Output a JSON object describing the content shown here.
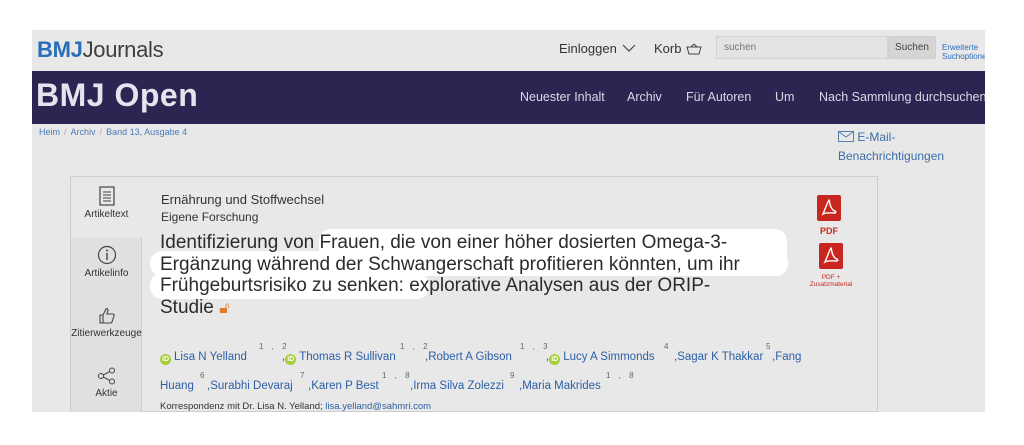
{
  "header": {
    "logo_brand": "BMJ",
    "logo_rest": "Journals",
    "login_label": "Einloggen",
    "cart_label": "Korb",
    "search_placeholder": "suchen",
    "search_button": "Suchen",
    "advanced_search_line1": "Erweiterte",
    "advanced_search_line2": "Suchoptionen"
  },
  "navbar": {
    "journal": "BMJ Open",
    "items": [
      "Neuester Inhalt",
      "Archiv",
      "Für Autoren",
      "Um",
      "Nach Sammlung durchsuchen"
    ]
  },
  "breadcrumb": [
    "Heim",
    "Archiv",
    "Band 13, Ausgabe 4"
  ],
  "email_alerts": {
    "line1": "E-Mail-",
    "line2": "Benachrichtigungen"
  },
  "tabs": [
    {
      "label": "Artikeltext",
      "icon": "document-icon"
    },
    {
      "label": "Artikelinfo",
      "icon": "info-icon"
    },
    {
      "label": "Zitierwerkzeuge",
      "icon": "thumbs-up-icon"
    },
    {
      "label": "Aktie",
      "icon": "share-icon"
    }
  ],
  "article": {
    "subject": "Ernährung und Stoffwechsel",
    "kind": "Eigene Forschung",
    "title_lines": [
      "Identifizierung von Frauen, die von einer höher dosierten Omega-3-",
      "Ergänzung während der Schwangerschaft profitieren könnten, um ihr",
      "Frühgeburtsrisiko zu senken: explorative Analysen aus der ORIP-",
      "Studie"
    ],
    "pdf_label": "PDF",
    "pdf_plus_label": "PDF +",
    "pdf_plus_sub": "Zusatzmaterial",
    "authors_row1": [
      {
        "name": "Lisa N Yelland",
        "sup": "1 , 2",
        "orcid": true
      },
      {
        "name": "Thomas R Sullivan",
        "sup": "1 , 2",
        "orcid": true
      },
      {
        "name": "Robert A Gibson",
        "sup": "1 , 3",
        "orcid": false
      },
      {
        "name": "Lucy A Simmonds",
        "sup": "4",
        "orcid": true
      },
      {
        "name": "Sagar K Thakkar",
        "sup": "5",
        "orcid": false
      },
      {
        "name": "Fang",
        "sup": "",
        "orcid": false
      }
    ],
    "authors_row2": [
      {
        "name": "Huang",
        "sup": "6"
      },
      {
        "name": "Surabhi Devaraj",
        "sup": "7"
      },
      {
        "name": "Karen P Best",
        "sup": "1 , 8"
      },
      {
        "name": "Irma Silva Zolezzi",
        "sup": "9"
      },
      {
        "name": "Maria Makrides",
        "sup": "1 , 8"
      }
    ],
    "correspondence_text": "Korrespondenz mit Dr. Lisa N. Yelland;",
    "correspondence_email": "lisa.yelland@sahmri.com"
  }
}
